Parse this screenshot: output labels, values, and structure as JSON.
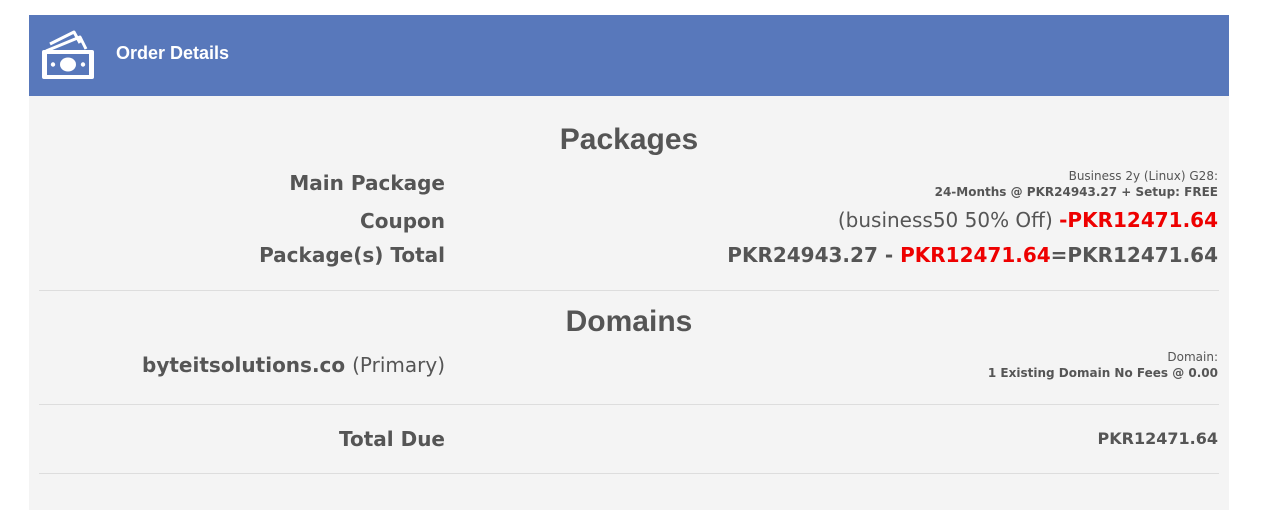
{
  "header": {
    "title": "Order Details",
    "icon": "money-bills-icon",
    "color": "#5878bb"
  },
  "packages": {
    "title": "Packages",
    "main_package": {
      "label": "Main Package",
      "name": "Business 2y (Linux) G28:",
      "detail": "24-Months @ PKR24943.27 + Setup: FREE"
    },
    "coupon": {
      "label": "Coupon",
      "description": "(business50 50% Off)",
      "discount": "-PKR12471.64"
    },
    "total": {
      "label": "Package(s) Total",
      "subtotal": "PKR24943.27 - ",
      "discount": "PKR12471.64",
      "result": "=PKR12471.64"
    }
  },
  "domains": {
    "title": "Domains",
    "items": [
      {
        "name": "byteitsolutions.co",
        "tag": "(Primary)",
        "type_label": "Domain:",
        "detail": "1 Existing Domain No Fees @ 0.00"
      }
    ]
  },
  "total_due": {
    "label": "Total Due",
    "value": "PKR12471.64"
  },
  "colors": {
    "accent": "#5878bb",
    "discount": "#ee0000",
    "text": "#555555",
    "panel_bg": "#f4f4f4"
  }
}
